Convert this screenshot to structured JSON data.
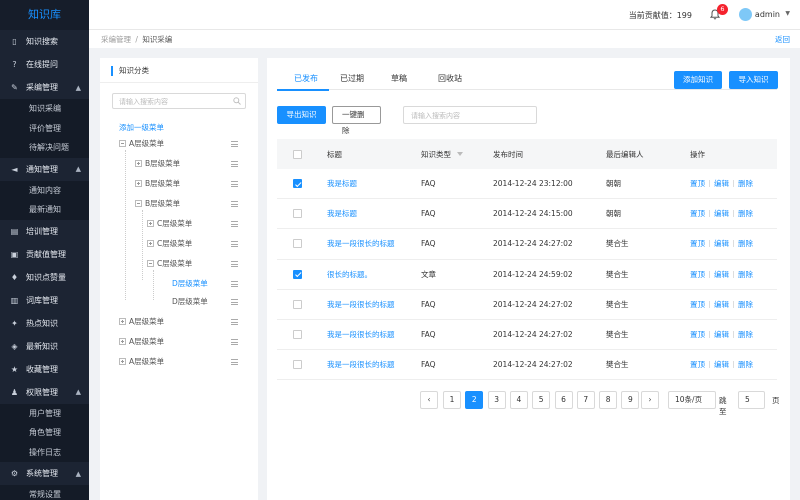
{
  "sidebar": {
    "logo": "知识库",
    "items": [
      {
        "label": "知识搜索",
        "icon": "book-icon"
      },
      {
        "label": "在线提问",
        "icon": "question-icon"
      },
      {
        "label": "采编管理",
        "icon": "edit-icon",
        "expanded": true,
        "children": [
          "知识采编",
          "评价管理",
          "待解决问题"
        ]
      },
      {
        "label": "通知管理",
        "icon": "speaker-icon",
        "expanded": true,
        "children": [
          "通知内容",
          "最新通知"
        ]
      },
      {
        "label": "培训管理",
        "icon": "training-icon"
      },
      {
        "label": "贡献值管理",
        "icon": "contribution-icon"
      },
      {
        "label": "知识点赞量",
        "icon": "thumbs-up-icon"
      },
      {
        "label": "词库管理",
        "icon": "dictionary-icon"
      },
      {
        "label": "热点知识",
        "icon": "hot-icon"
      },
      {
        "label": "最新知识",
        "icon": "new-icon"
      },
      {
        "label": "收藏管理",
        "icon": "star-icon"
      },
      {
        "label": "权限管理",
        "icon": "permission-icon",
        "expanded": true,
        "children": [
          "用户管理",
          "角色管理",
          "操作日志"
        ]
      },
      {
        "label": "系统管理",
        "icon": "gear-icon",
        "expanded": true,
        "children": [
          "常规设置"
        ]
      }
    ]
  },
  "header": {
    "contribution": "当前贡献值：199",
    "notification_count": "6",
    "username": "admin"
  },
  "breadcrumb": {
    "parent": "采编管理",
    "separator": "/",
    "current": "知识采编",
    "back": "返回"
  },
  "category_panel": {
    "title": "知识分类",
    "search_placeholder": "请输入搜索内容",
    "add_first_level": "添加一级菜单",
    "tree": [
      {
        "label": "A层级菜单",
        "expanded": true
      },
      {
        "label": "B层级菜单",
        "expanded": false
      },
      {
        "label": "B层级菜单",
        "expanded": false
      },
      {
        "label": "B层级菜单",
        "expanded": true
      },
      {
        "label": "C层级菜单",
        "expanded": false
      },
      {
        "label": "C层级菜单",
        "expanded": false
      },
      {
        "label": "C层级菜单",
        "expanded": true
      },
      {
        "label": "D层级菜单",
        "selected": true
      },
      {
        "label": "D层级菜单"
      },
      {
        "label": "A层级菜单",
        "expanded": false
      },
      {
        "label": "A层级菜单",
        "expanded": false
      },
      {
        "label": "A层级菜单",
        "expanded": false
      }
    ]
  },
  "main": {
    "tabs": [
      "已发布",
      "已过期",
      "草稿",
      "回收站"
    ],
    "active_tab": "已发布",
    "add_button": "添加知识",
    "import_button": "导入知识",
    "export_button": "导出知识",
    "delete_all_button": "一键删除",
    "search_placeholder": "请输入搜索内容",
    "table": {
      "headers": [
        "标题",
        "知识类型",
        "发布时间",
        "最后编辑人",
        "操作"
      ],
      "rows": [
        {
          "checked": true,
          "title": "我是标题",
          "type": "FAQ",
          "time": "2014-12-24  23:12:00",
          "editor": "朝朝"
        },
        {
          "checked": false,
          "title": "我是标题",
          "type": "FAQ",
          "time": "2014-12-24  24:15:00",
          "editor": "朝朝"
        },
        {
          "checked": false,
          "title": "我是一段很长的标题",
          "type": "FAQ",
          "time": "2014-12-24  24:27:02",
          "editor": "樊合生"
        },
        {
          "checked": true,
          "title": "很长的标题。",
          "type": "文章",
          "time": "2014-12-24  24:59:02",
          "editor": "樊合生"
        },
        {
          "checked": false,
          "title": "我是一段很长的标题",
          "type": "FAQ",
          "time": "2014-12-24  24:27:02",
          "editor": "樊合生"
        },
        {
          "checked": false,
          "title": "我是一段很长的标题",
          "type": "FAQ",
          "time": "2014-12-24  24:27:02",
          "editor": "樊合生"
        },
        {
          "checked": false,
          "title": "我是一段很长的标题",
          "type": "FAQ",
          "time": "2014-12-24  24:27:02",
          "editor": "樊合生"
        }
      ],
      "actions": [
        "置顶",
        "编辑",
        "删除"
      ]
    },
    "pagination": {
      "pages": [
        "1",
        "2",
        "3",
        "4",
        "5",
        "6",
        "7",
        "8",
        "9"
      ],
      "current": "2",
      "page_size": "10条/页",
      "jump_label": "跳至",
      "jump_value": "5",
      "page_unit": "页"
    }
  },
  "colors": {
    "accent": "#1890ff",
    "sidebar_bg": "#1c2433",
    "badge": "#f5222d"
  }
}
